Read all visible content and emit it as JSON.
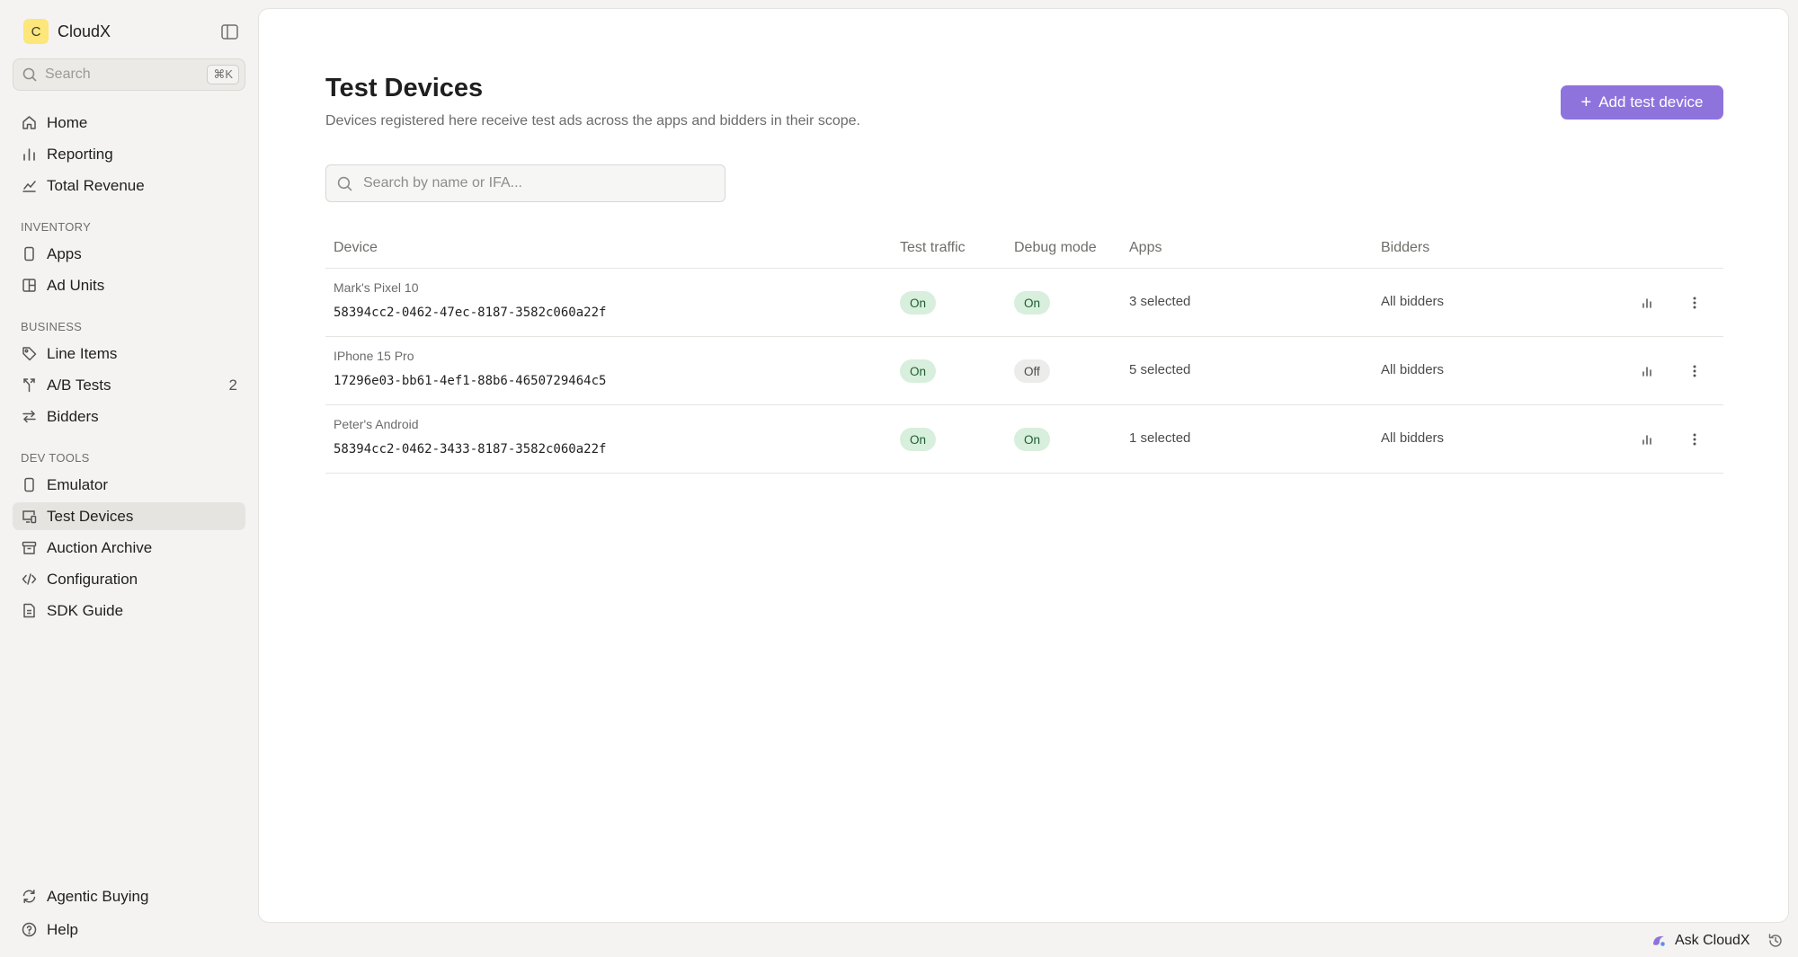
{
  "app": {
    "logo_letter": "C",
    "name": "CloudX"
  },
  "sidebar": {
    "search_placeholder": "Search",
    "search_shortcut": "⌘K",
    "top_items": [
      {
        "label": "Home",
        "icon": "home-icon"
      },
      {
        "label": "Reporting",
        "icon": "bar-chart-icon"
      },
      {
        "label": "Total Revenue",
        "icon": "trend-chart-icon"
      }
    ],
    "sections": [
      {
        "label": "INVENTORY",
        "items": [
          {
            "label": "Apps",
            "icon": "phone-icon"
          },
          {
            "label": "Ad Units",
            "icon": "layout-icon"
          }
        ]
      },
      {
        "label": "BUSINESS",
        "items": [
          {
            "label": "Line Items",
            "icon": "tag-icon"
          },
          {
            "label": "A/B Tests",
            "icon": "split-icon",
            "count": "2"
          },
          {
            "label": "Bidders",
            "icon": "arrows-exchange-icon"
          }
        ]
      },
      {
        "label": "DEV TOOLS",
        "items": [
          {
            "label": "Emulator",
            "icon": "phone-icon"
          },
          {
            "label": "Test Devices",
            "icon": "devices-icon",
            "active": true
          },
          {
            "label": "Auction Archive",
            "icon": "archive-icon"
          },
          {
            "label": "Configuration",
            "icon": "code-icon"
          },
          {
            "label": "SDK Guide",
            "icon": "file-text-icon"
          }
        ]
      }
    ],
    "bottom_items": [
      {
        "label": "Agentic Buying",
        "icon": "refresh-arrows-icon"
      },
      {
        "label": "Help",
        "icon": "help-circle-icon"
      }
    ]
  },
  "page": {
    "title": "Test Devices",
    "subtitle": "Devices registered here receive test ads across the apps and bidders in their scope.",
    "add_button_label": "Add test device",
    "search_placeholder": "Search by name or IFA..."
  },
  "table": {
    "columns": [
      "Device",
      "Test traffic",
      "Debug mode",
      "Apps",
      "Bidders"
    ],
    "rows": [
      {
        "name": "Mark's Pixel 10",
        "ifa": "58394cc2-0462-47ec-8187-3582c060a22f",
        "test_traffic": "On",
        "debug_mode": "On",
        "apps": "3 selected",
        "bidders": "All bidders"
      },
      {
        "name": "IPhone 15 Pro",
        "ifa": "17296e03-bb61-4ef1-88b6-4650729464c5",
        "test_traffic": "On",
        "debug_mode": "Off",
        "apps": "5 selected",
        "bidders": "All bidders"
      },
      {
        "name": "Peter's Android",
        "ifa": "58394cc2-0462-3433-8187-3582c060a22f",
        "test_traffic": "On",
        "debug_mode": "On",
        "apps": "1 selected",
        "bidders": "All bidders"
      }
    ]
  },
  "footer": {
    "ask_label": "Ask CloudX"
  },
  "colors": {
    "accent": "#8f73dd",
    "pill_on_bg": "#d7efdc",
    "pill_off_bg": "#ececea",
    "logo_bg": "#fde67a"
  }
}
